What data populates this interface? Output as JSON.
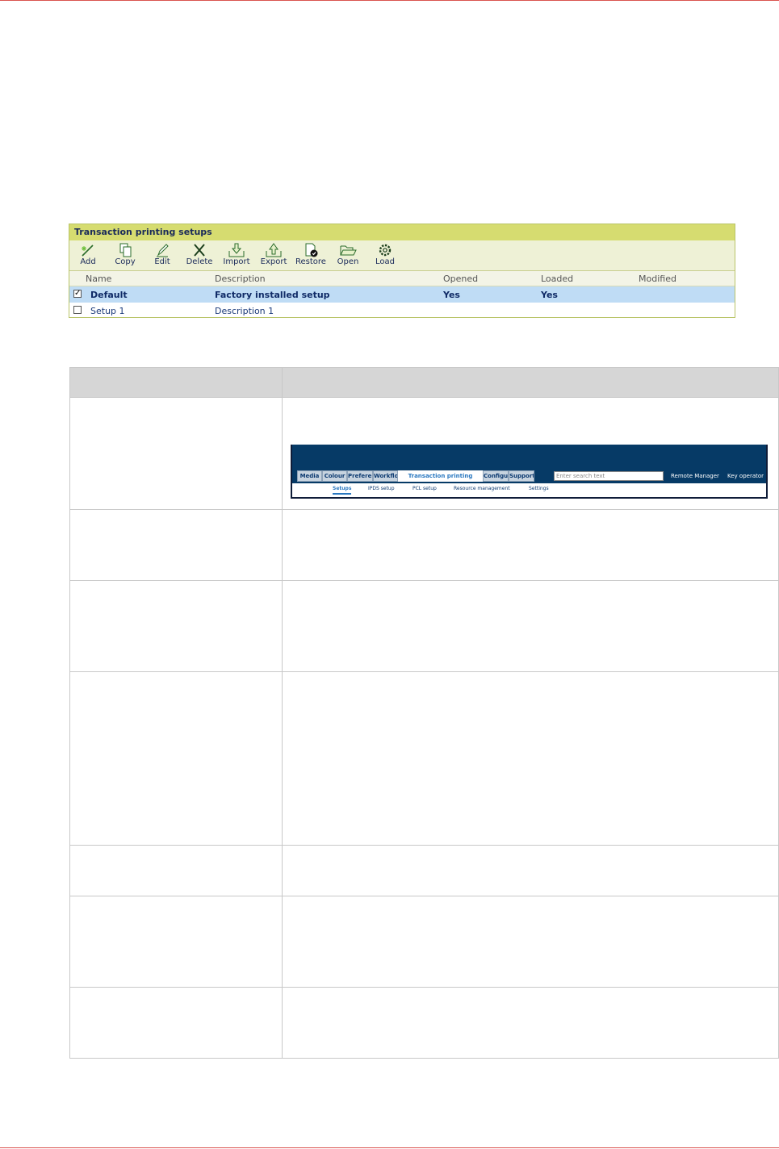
{
  "panel": {
    "title": "Transaction printing setups",
    "toolbar": [
      {
        "label": "Add",
        "icon": "add-icon"
      },
      {
        "label": "Copy",
        "icon": "copy-icon"
      },
      {
        "label": "Edit",
        "icon": "edit-icon"
      },
      {
        "label": "Delete",
        "icon": "delete-icon"
      },
      {
        "label": "Import",
        "icon": "import-icon"
      },
      {
        "label": "Export",
        "icon": "export-icon"
      },
      {
        "label": "Restore",
        "icon": "restore-icon"
      },
      {
        "label": "Open",
        "icon": "open-icon"
      },
      {
        "label": "Load",
        "icon": "load-icon"
      }
    ],
    "columns": [
      "Name",
      "Description",
      "Opened",
      "Loaded",
      "Modified"
    ],
    "rows": [
      {
        "checked": true,
        "name": "Default",
        "description": "Factory installed setup",
        "opened": "Yes",
        "loaded": "Yes",
        "modified": ""
      },
      {
        "checked": false,
        "name": "Setup 1",
        "description": "Description 1",
        "opened": "",
        "loaded": "",
        "modified": ""
      }
    ]
  },
  "nav_screenshot": {
    "tabs": [
      "Media",
      "Colour",
      "Preferen",
      "Workflo",
      "Transaction printing",
      "Configu",
      "Support"
    ],
    "search_placeholder": "Enter search text",
    "links": [
      "Remote Manager",
      "Key operator"
    ],
    "subtabs": [
      "Setups",
      "IPDS setup",
      "PCL setup",
      "Resource management",
      "Settings"
    ]
  },
  "colors": {
    "accent_line": "#d9534f",
    "panel_title_bg": "#d6dc70",
    "selected_row_bg": "#bfdcf5",
    "nav_bar_bg": "#063a66"
  }
}
